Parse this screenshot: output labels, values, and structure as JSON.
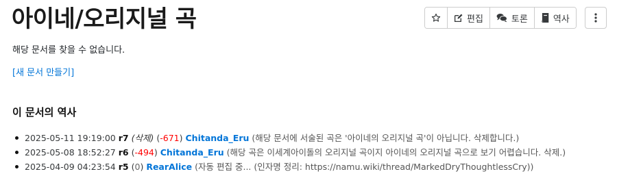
{
  "page": {
    "title": "아이네/오리지널 곡",
    "notice": "해당 문서를 찾을 수 없습니다.",
    "create_link": "[새 문서 만들기]"
  },
  "toolbar": {
    "edit_label": "편집",
    "discuss_label": "토론",
    "history_label": "역사"
  },
  "history": {
    "title": "이 문서의 역사",
    "items": [
      {
        "datetime": "2025-05-11 19:19:00",
        "rev": "r7",
        "action": "(삭제)",
        "change_open": "(",
        "change": "-671",
        "change_close": ")",
        "user": "Chitanda_Eru",
        "comment": "(해당 문서에 서술된 곡은 '아이네의 오리지널 곡'이 아닙니다. 삭제합니다.)"
      },
      {
        "datetime": "2025-05-08 18:52:27",
        "rev": "r6",
        "action": "",
        "change_open": "(",
        "change": "-494",
        "change_close": ")",
        "user": "Chitanda_Eru",
        "comment": "(해당 곡은 이세계아이돌의 오리지널 곡이지 아이네의 오리지널 곡으로 보기 어렵습니다. 삭제.)"
      },
      {
        "datetime": "2025-04-09 04:23:54",
        "rev": "r5",
        "action": "",
        "change_open": "(",
        "change": "0",
        "change_close": ")",
        "user": "RearAlice",
        "comment": "(자동 편집 중... (인자명 정리: https://namu.wiki/thread/MarkedDryThoughtlessCry))"
      }
    ]
  }
}
